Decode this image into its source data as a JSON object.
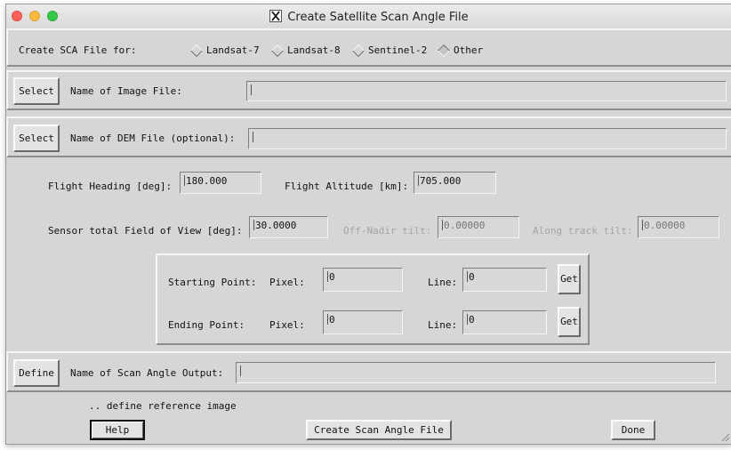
{
  "window": {
    "title": "Create Satellite Scan Angle File"
  },
  "sca_for": {
    "label": "Create SCA File for:",
    "options": [
      "Landsat-7",
      "Landsat-8",
      "Sentinel-2",
      "Other"
    ],
    "selected": "Other"
  },
  "image_file": {
    "button": "Select",
    "label": "Name of Image File:",
    "value": ""
  },
  "dem_file": {
    "button": "Select",
    "label": "Name of DEM File (optional):",
    "value": ""
  },
  "params": {
    "heading_label": "Flight Heading [deg]:",
    "heading_value": "180.000",
    "altitude_label": "Flight Altitude [km]:",
    "altitude_value": "705.000",
    "fov_label": "Sensor total Field of View [deg]:",
    "fov_value": "30.0000",
    "offnadir_label": "Off-Nadir tilt:",
    "offnadir_value": "0.00000",
    "alongtrack_label": "Along track tilt:",
    "alongtrack_value": "0.00000"
  },
  "points": {
    "pixel_label": "Pixel:",
    "line_label": "Line:",
    "get_label": "Get",
    "start": {
      "label": "Starting Point:",
      "pixel": "0",
      "line": "0"
    },
    "end": {
      "label": "Ending Point:",
      "pixel": "0",
      "line": "0"
    }
  },
  "output": {
    "button": "Define",
    "label": "Name of Scan Angle Output:",
    "value": ""
  },
  "status": {
    "text": ".. define reference image"
  },
  "buttons": {
    "help": "Help",
    "create": "Create Scan Angle File",
    "done": "Done"
  },
  "colors": {
    "close": "#fc605b",
    "minimize": "#fdbc40",
    "maximize": "#34c84a",
    "window_bg": "#d6d6d6"
  }
}
